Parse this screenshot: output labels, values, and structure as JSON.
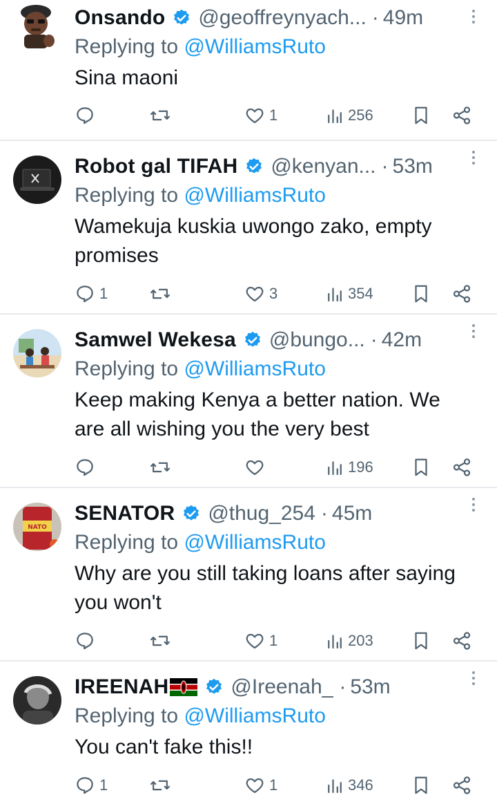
{
  "replies": [
    {
      "name": "Onsando",
      "handle": "@geoffreynyach...",
      "time": "49m",
      "replying_label": "Replying to",
      "replying_to": "@WilliamsRuto",
      "text": "Sina maoni",
      "counts": {
        "replies": "",
        "reposts": "",
        "likes": "1",
        "views": "256"
      },
      "avatar_icon": "memoji-avatar",
      "accent": "#1d9bf0"
    },
    {
      "name": "Robot gal TIFAH",
      "handle": "@kenyan...",
      "time": "53m",
      "replying_label": "Replying to",
      "replying_to": "@WilliamsRuto",
      "text": "Wamekuja kuskia uwongo zako, empty promises",
      "counts": {
        "replies": "1",
        "reposts": "",
        "likes": "3",
        "views": "354"
      },
      "avatar_icon": "laptop-x-avatar"
    },
    {
      "name": "Samwel Wekesa",
      "handle": "@bungo...",
      "time": "42m",
      "replying_label": "Replying to",
      "replying_to": "@WilliamsRuto",
      "text": "Keep making Kenya a better nation. We are all wishing you the very best",
      "counts": {
        "replies": "",
        "reposts": "",
        "likes": "",
        "views": "196"
      },
      "avatar_icon": "illustration-avatar"
    },
    {
      "name": "SENATOR",
      "handle": "@thug_254",
      "time": "45m",
      "replying_label": "Replying to",
      "replying_to": "@WilliamsRuto",
      "text": "Why are you still taking loans after saying you won't",
      "counts": {
        "replies": "",
        "reposts": "",
        "likes": "1",
        "views": "203"
      },
      "avatar_icon": "senator-can-avatar"
    },
    {
      "name": "IREENAH",
      "flag": "kenya-flag-icon",
      "handle": "@Ireenah_",
      "time": "53m",
      "replying_label": "Replying to",
      "replying_to": "@WilliamsRuto",
      "text": "You can't fake this!!",
      "counts": {
        "replies": "1",
        "reposts": "",
        "likes": "1",
        "views": "346"
      },
      "avatar_icon": "photo-avatar"
    }
  ],
  "dot": "·"
}
